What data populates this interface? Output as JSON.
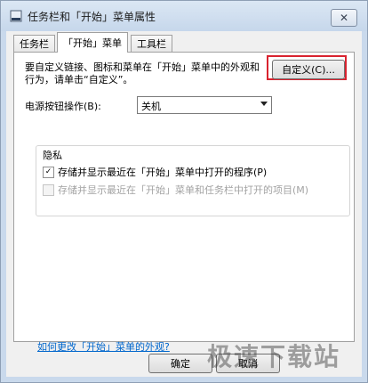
{
  "window": {
    "title": "任务栏和「开始」菜单属性",
    "close_label": "✕"
  },
  "tabs": [
    {
      "label": "任务栏",
      "active": false
    },
    {
      "label": "「开始」菜单",
      "active": true
    },
    {
      "label": "工具栏",
      "active": false
    }
  ],
  "start_menu": {
    "description": "要自定义链接、图标和菜单在「开始」菜单中的外观和行为，请单击“自定义”。",
    "customize_button": "自定义(C)...",
    "power_label": "电源按钮操作(B):",
    "power_value": "关机",
    "privacy_title": "隐私",
    "privacy_options": [
      {
        "label": "存储并显示最近在「开始」菜单中打开的程序(P)",
        "checked": true,
        "enabled": true
      },
      {
        "label": "存储并显示最近在「开始」菜单和任务栏中打开的项目(M)",
        "checked": true,
        "enabled": false
      }
    ],
    "link": "如何更改「开始」菜单的外观?"
  },
  "footer": {
    "ok_button": "确定",
    "cancel_button": "取消"
  },
  "watermark": "极速下载站",
  "colors": {
    "highlight": "#d9232f",
    "link": "#0066cc"
  }
}
